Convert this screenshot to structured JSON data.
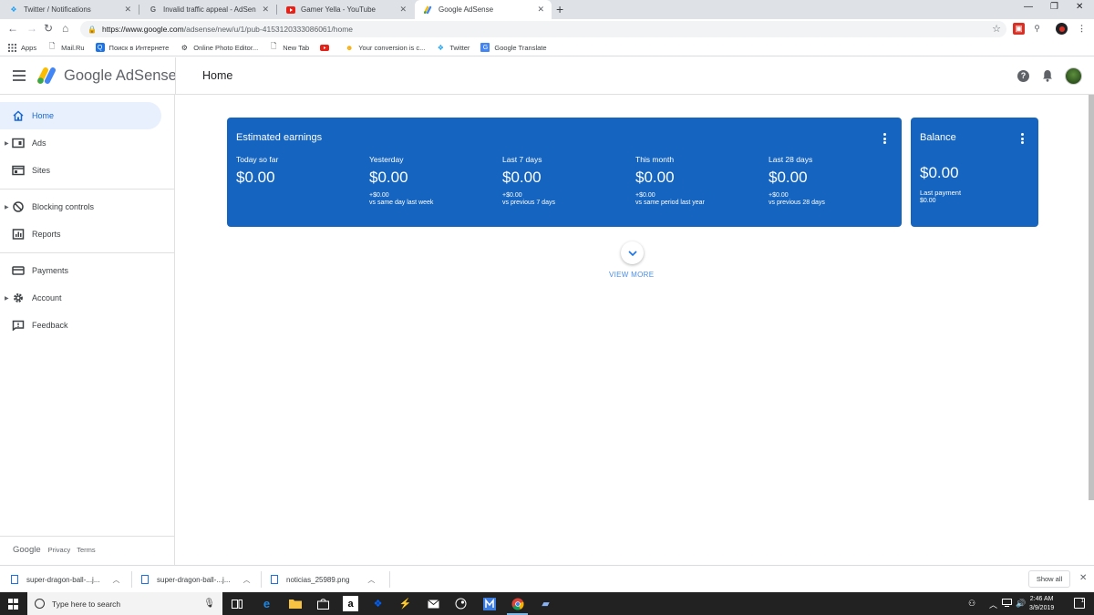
{
  "browser": {
    "tabs": [
      {
        "title": "Twitter / Notifications",
        "icon": "twitter-icon"
      },
      {
        "title": "Invalid traffic appeal - AdSense H",
        "icon": "google-icon"
      },
      {
        "title": "Gamer Yella - YouTube",
        "icon": "youtube-icon"
      },
      {
        "title": "Google AdSense",
        "icon": "adsense-icon",
        "active": true
      }
    ],
    "url_host": "https://www.google.com",
    "url_path": "/adsense/new/u/1/pub-4153120333086061/home",
    "bookmarks": [
      {
        "label": "Apps",
        "icon": "apps-grid-icon"
      },
      {
        "label": "Mail.Ru",
        "icon": "page-icon"
      },
      {
        "label": "Поиск в Интернете",
        "icon": "search-bookmark-icon"
      },
      {
        "label": "Online Photo Editor...",
        "icon": "photo-editor-icon"
      },
      {
        "label": "New Tab",
        "icon": "page-icon"
      },
      {
        "label": "",
        "icon": "youtube-icon"
      },
      {
        "label": "Your conversion is c...",
        "icon": "conversion-icon"
      },
      {
        "label": "Twitter",
        "icon": "twitter-icon"
      },
      {
        "label": "Google Translate",
        "icon": "translate-icon"
      }
    ]
  },
  "app": {
    "product": "Google AdSense",
    "page_title": "Home"
  },
  "sidebar": {
    "items": [
      {
        "label": "Home",
        "icon": "home-icon",
        "active": true
      },
      {
        "label": "Ads",
        "icon": "ads-icon",
        "expandable": true
      },
      {
        "label": "Sites",
        "icon": "sites-icon"
      },
      {
        "label": "Blocking controls",
        "icon": "block-icon",
        "expandable": true
      },
      {
        "label": "Reports",
        "icon": "reports-icon"
      },
      {
        "label": "Payments",
        "icon": "payments-icon"
      },
      {
        "label": "Account",
        "icon": "gear-icon",
        "expandable": true
      },
      {
        "label": "Feedback",
        "icon": "feedback-icon"
      }
    ],
    "footer": {
      "google": "Google",
      "privacy": "Privacy",
      "terms": "Terms"
    }
  },
  "earnings": {
    "title": "Estimated earnings",
    "metrics": [
      {
        "label": "Today so far",
        "value": "$0.00",
        "delta": "",
        "compare": ""
      },
      {
        "label": "Yesterday",
        "value": "$0.00",
        "delta": "+$0.00",
        "compare": "vs same day last week"
      },
      {
        "label": "Last 7 days",
        "value": "$0.00",
        "delta": "+$0.00",
        "compare": "vs previous 7 days"
      },
      {
        "label": "This month",
        "value": "$0.00",
        "delta": "+$0.00",
        "compare": "vs same period last year"
      },
      {
        "label": "Last 28 days",
        "value": "$0.00",
        "delta": "+$0.00",
        "compare": "vs previous 28 days"
      }
    ]
  },
  "balance": {
    "title": "Balance",
    "value": "$0.00",
    "last_payment_label": "Last payment",
    "last_payment_value": "$0.00"
  },
  "view_more": "VIEW MORE",
  "downloads": {
    "items": [
      "super-dragon-ball-...j...",
      "super-dragon-ball-...j...",
      "noticias_25989.png"
    ],
    "show_all": "Show all"
  },
  "taskbar": {
    "search_placeholder": "Type here to search",
    "time": "2:46 AM",
    "date": "3/9/2019",
    "notification_count": "1"
  },
  "colors": {
    "card_blue": "#1565c0",
    "active_nav_bg": "#e8f0fe",
    "active_nav_text": "#1967d2",
    "link_blue": "#4c8ee6"
  }
}
